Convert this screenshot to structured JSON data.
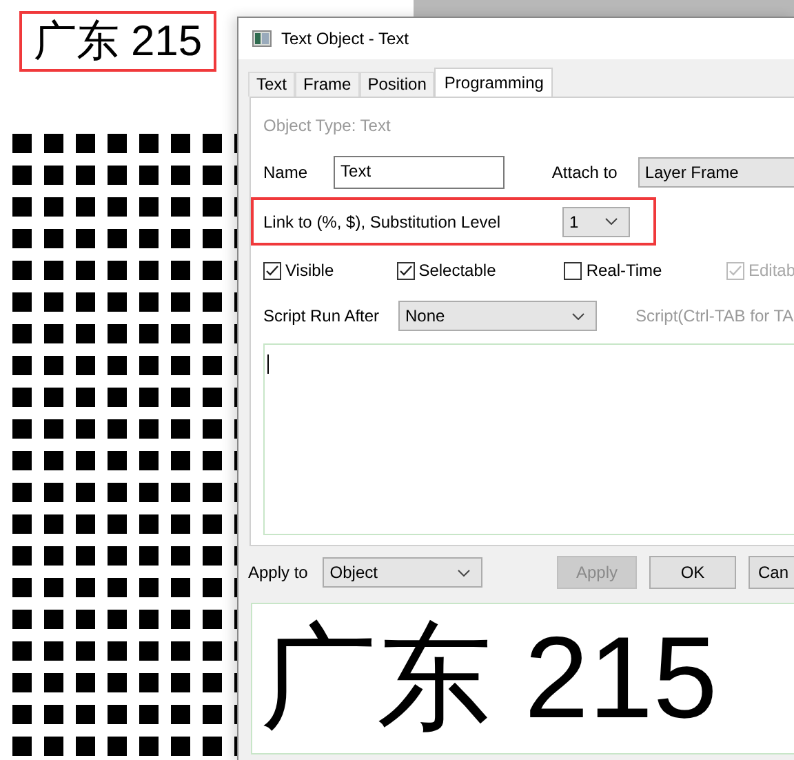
{
  "canvas": {
    "label": "广东 215"
  },
  "dialog": {
    "title": "Text Object - Text",
    "tabs": [
      {
        "label": "Text",
        "selected": false
      },
      {
        "label": "Frame",
        "selected": false
      },
      {
        "label": "Position",
        "selected": false
      },
      {
        "label": "Programming",
        "selected": true
      }
    ],
    "object_type": "Object Type: Text",
    "name": {
      "label": "Name",
      "value": "Text"
    },
    "attach": {
      "label": "Attach to",
      "value": "Layer Frame"
    },
    "link": {
      "label": "Link to (%, $), Substitution Level",
      "value": "1"
    },
    "checks": [
      {
        "label": "Visible",
        "checked": true,
        "disabled": false
      },
      {
        "label": "Selectable",
        "checked": true,
        "disabled": false
      },
      {
        "label": "Real-Time",
        "checked": false,
        "disabled": false
      },
      {
        "label": "Editab",
        "checked": true,
        "disabled": true
      }
    ],
    "script_run_after": {
      "label": "Script Run After",
      "value": "None"
    },
    "script_hint": "Script(Ctrl-TAB for TA",
    "apply_to": {
      "label": "Apply to",
      "value": "Object"
    },
    "buttons": [
      {
        "label": "Apply",
        "disabled": true
      },
      {
        "label": "OK",
        "disabled": false
      },
      {
        "label": "Can",
        "disabled": false
      }
    ],
    "preview": "广东 215"
  }
}
